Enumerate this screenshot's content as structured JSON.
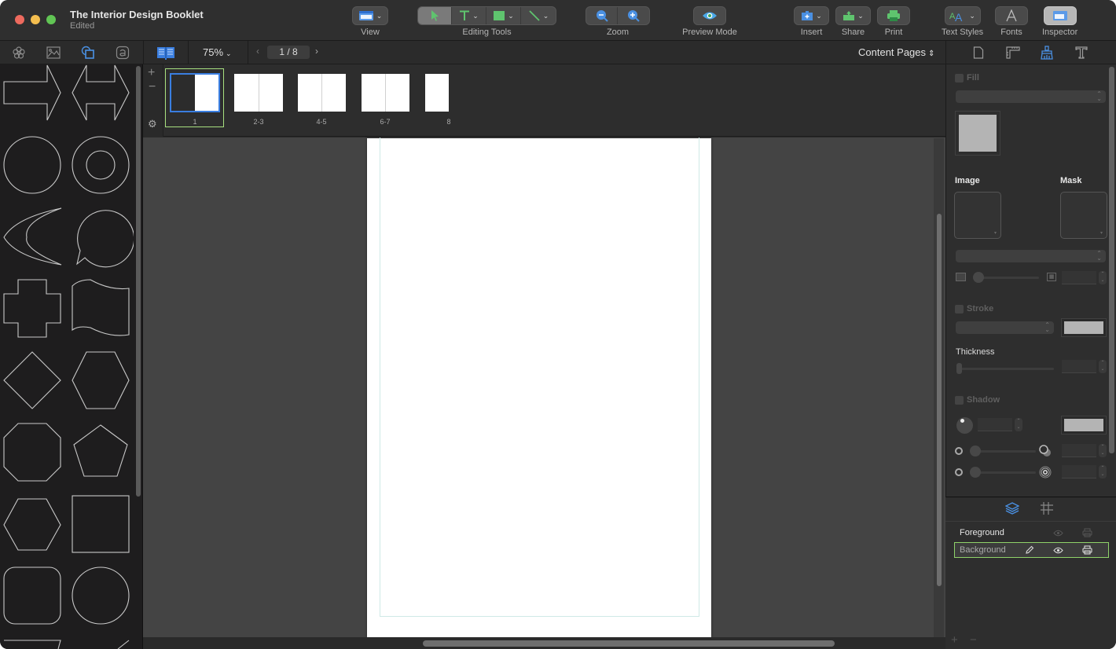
{
  "window": {
    "title": "The Interior Design Booklet",
    "subtitle": "Edited"
  },
  "toolbar": {
    "view_label": "View",
    "editing_tools_label": "Editing Tools",
    "zoom_label": "Zoom",
    "preview_label": "Preview Mode",
    "insert_label": "Insert",
    "share_label": "Share",
    "print_label": "Print",
    "text_styles_label": "Text Styles",
    "fonts_label": "Fonts",
    "inspector_label": "Inspector",
    "accent": "#4a90e2",
    "tool_green": "#5fc46e"
  },
  "subbar": {
    "library_tabs": [
      "templates",
      "images",
      "shapes",
      "text"
    ],
    "active_library_tab": "shapes",
    "zoom_value": "75%",
    "page_indicator": "1 / 8",
    "page_type": "Content Pages"
  },
  "library": {
    "shapes": [
      "arrow-right",
      "arrow-double",
      "circle",
      "donut",
      "crescent",
      "speech-bubble",
      "cross",
      "wave-flag",
      "diamond",
      "hexagon",
      "octagon",
      "pentagon",
      "hexagon-flat",
      "square",
      "rounded-square",
      "circle-2",
      "trapezoid",
      "triangle"
    ]
  },
  "pages": {
    "thumbnails": [
      {
        "label": "1",
        "selected": true
      },
      {
        "label": "2-3",
        "selected": false
      },
      {
        "label": "4-5",
        "selected": false
      },
      {
        "label": "6-7",
        "selected": false
      },
      {
        "label": "8",
        "selected": false
      }
    ]
  },
  "inspector": {
    "tabs": [
      "document",
      "layout",
      "style",
      "text"
    ],
    "active_tab": "style",
    "fill_label": "Fill",
    "image_label": "Image",
    "mask_label": "Mask",
    "stroke_label": "Stroke",
    "thickness_label": "Thickness",
    "shadow_label": "Shadow",
    "fill_swatch": "#b4b4b4",
    "stroke_swatch": "#b4b4b4",
    "shadow_swatch": "#b4b4b4"
  },
  "layers": {
    "tabs": [
      "layers",
      "grid"
    ],
    "items": [
      {
        "name": "Foreground",
        "selected": false
      },
      {
        "name": "Background",
        "selected": true
      }
    ],
    "selection_color": "#8fd36a"
  }
}
